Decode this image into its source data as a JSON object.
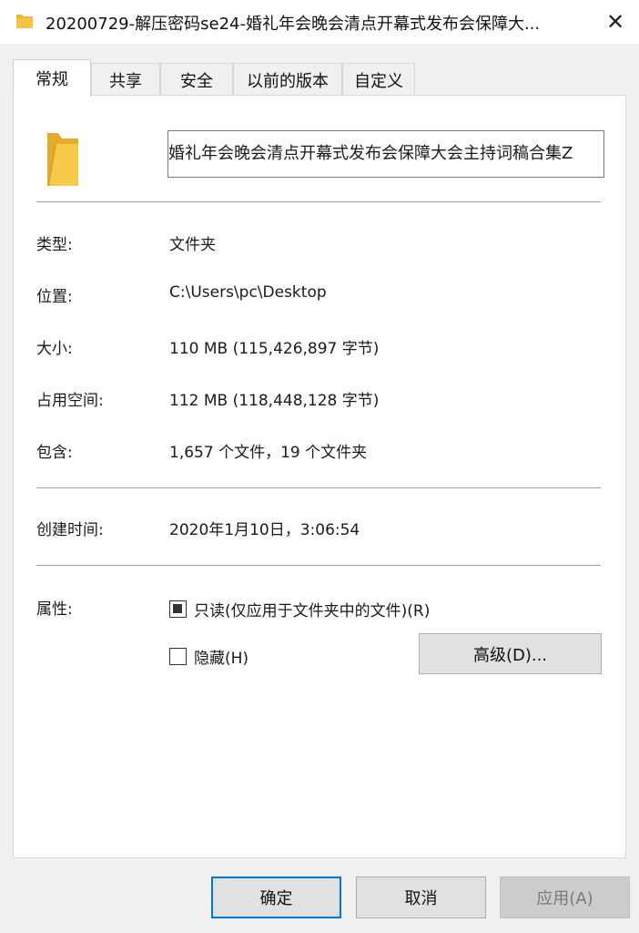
{
  "window": {
    "title": "20200729-解压密码se24-婚礼年会晚会清点开幕式发布会保障大...",
    "close_label": "✕"
  },
  "tabs": [
    {
      "label": "常规",
      "active": true
    },
    {
      "label": "共享",
      "active": false
    },
    {
      "label": "安全",
      "active": false
    },
    {
      "label": "以前的版本",
      "active": false
    },
    {
      "label": "自定义",
      "active": false
    }
  ],
  "general": {
    "name_value": "婚礼年会晚会清点开幕式发布会保障大会主持词稿合集Z",
    "type_label": "类型:",
    "type_value": "文件夹",
    "location_label": "位置:",
    "location_value": "C:\\Users\\pc\\Desktop",
    "size_label": "大小:",
    "size_value": "110 MB (115,426,897 字节)",
    "size_on_disk_label": "占用空间:",
    "size_on_disk_value": "112 MB (118,448,128 字节)",
    "contains_label": "包含:",
    "contains_value": "1,657 个文件，19 个文件夹",
    "created_label": "创建时间:",
    "created_value": "2020年1月10日，3:06:54",
    "attributes_label": "属性:",
    "readonly_label": "只读(仅应用于文件夹中的文件)(R)",
    "readonly_checked": true,
    "hidden_label": "隐藏(H)",
    "hidden_checked": false,
    "advanced_label": "高级(D)..."
  },
  "footer": {
    "ok_label": "确定",
    "cancel_label": "取消",
    "apply_label": "应用(A)"
  },
  "colors": {
    "folder": "#f5c542",
    "accent": "#0078d7"
  },
  "icons": {
    "title": "folder-icon",
    "body": "folder-icon",
    "close": "close-icon"
  }
}
